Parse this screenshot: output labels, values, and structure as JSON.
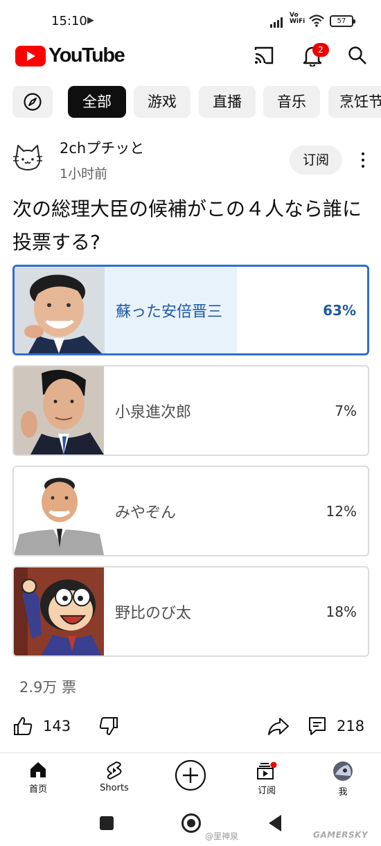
{
  "status_bar": {
    "time": "15:10",
    "vowifi_top": "Vo",
    "vowifi_bottom": "WiFi",
    "battery": "57"
  },
  "app": {
    "brand": "YouTube",
    "notification_count": "2"
  },
  "chips": [
    "全部",
    "游戏",
    "直播",
    "音乐",
    "烹饪节"
  ],
  "post": {
    "channel": "2chプチッと",
    "time": "1小时前",
    "subscribe_label": "订阅",
    "question": "次の総理大臣の候補がこの４人なら誰に投票する?",
    "options": [
      {
        "label": "蘇った安倍晋三",
        "percent": "63%",
        "value": 63
      },
      {
        "label": "小泉進次郎",
        "percent": "7%",
        "value": 7
      },
      {
        "label": "みやぞん",
        "percent": "12%",
        "value": 12
      },
      {
        "label": "野比のび太",
        "percent": "18%",
        "value": 18
      }
    ],
    "votes": "2.9万 票",
    "likes": "143",
    "comments": "218"
  },
  "bottom_nav": {
    "home": "首页",
    "shorts": "Shorts",
    "subscriptions": "订阅",
    "you": "我"
  },
  "watermarks": {
    "weibo": "@里神泉",
    "site": "GAMERSKY"
  },
  "colors": {
    "youtube_red": "#ff0000",
    "poll_selected": "#2f6fcf",
    "badge": "#ee0000"
  }
}
